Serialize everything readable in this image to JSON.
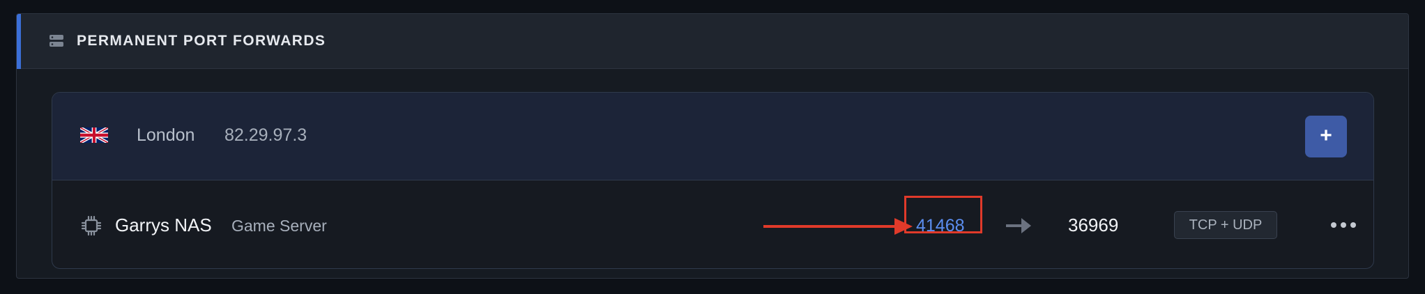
{
  "section": {
    "title": "PERMANENT PORT FORWARDS",
    "icon": "server-icon",
    "accent_color": "#3b6fd8"
  },
  "location": {
    "flag": "uk-flag-icon",
    "city": "London",
    "ip": "82.29.97.3",
    "add_label": "+"
  },
  "forward": {
    "device_icon": "chip-icon",
    "device_name": "Garrys NAS",
    "device_type": "Game Server",
    "external_port": "41468",
    "external_port_color": "#5b8ef0",
    "internal_port": "36969",
    "protocol": "TCP + UDP",
    "more_icon": "more-horizontal-icon",
    "annotation_color": "#e03a2a"
  }
}
